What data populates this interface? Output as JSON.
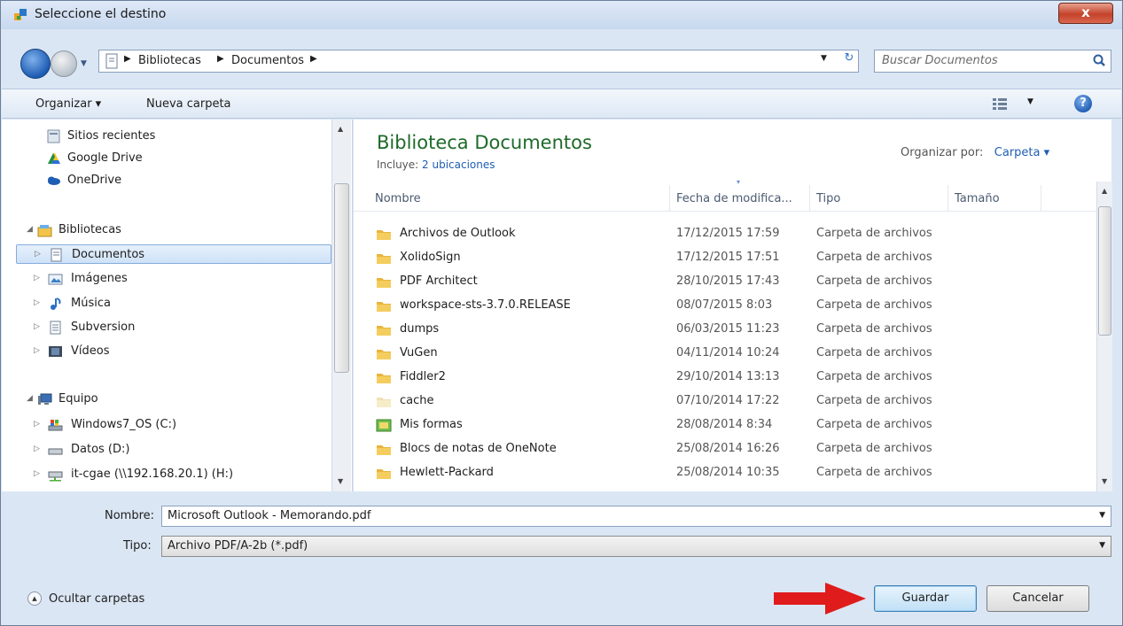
{
  "window": {
    "title": "Seleccione el destino",
    "close_label": "x"
  },
  "address": {
    "crumbs": [
      "Bibliotecas",
      "Documentos"
    ],
    "search_placeholder": "Buscar Documentos"
  },
  "toolbar": {
    "organize": "Organizar ▾",
    "new_folder": "Nueva carpeta"
  },
  "nav": {
    "items": [
      {
        "label": "Sitios recientes",
        "icon": "recent-places-icon"
      },
      {
        "label": "Google Drive",
        "icon": "google-drive-icon"
      },
      {
        "label": "OneDrive",
        "icon": "onedrive-icon"
      },
      {
        "label": "Bibliotecas",
        "icon": "libraries-icon"
      },
      {
        "label": "Documentos",
        "icon": "documents-icon"
      },
      {
        "label": "Imágenes",
        "icon": "pictures-icon"
      },
      {
        "label": "Música",
        "icon": "music-icon"
      },
      {
        "label": "Subversion",
        "icon": "subversion-icon"
      },
      {
        "label": "Vídeos",
        "icon": "videos-icon"
      },
      {
        "label": "Equipo",
        "icon": "computer-icon"
      },
      {
        "label": "Windows7_OS (C:)",
        "icon": "drive-c-icon"
      },
      {
        "label": "Datos (D:)",
        "icon": "drive-d-icon"
      },
      {
        "label": "it-cgae (\\\\192.168.20.1) (H:)",
        "icon": "network-drive-icon"
      }
    ]
  },
  "library": {
    "title": "Biblioteca Documentos",
    "includes_label": "Incluye:",
    "includes_link": "2 ubicaciones",
    "arrange_label": "Organizar por:",
    "arrange_value": "Carpeta ▾"
  },
  "columns": [
    "Nombre",
    "Fecha de modifica...",
    "Tipo",
    "Tamaño"
  ],
  "files": [
    {
      "name": "Archivos de Outlook",
      "date": "17/12/2015 17:59",
      "type": "Carpeta de archivos"
    },
    {
      "name": "XolidoSign",
      "date": "17/12/2015 17:51",
      "type": "Carpeta de archivos"
    },
    {
      "name": "PDF Architect",
      "date": "28/10/2015 17:43",
      "type": "Carpeta de archivos"
    },
    {
      "name": "workspace-sts-3.7.0.RELEASE",
      "date": "08/07/2015 8:03",
      "type": "Carpeta de archivos"
    },
    {
      "name": "dumps",
      "date": "06/03/2015 11:23",
      "type": "Carpeta de archivos"
    },
    {
      "name": "VuGen",
      "date": "04/11/2014 10:24",
      "type": "Carpeta de archivos"
    },
    {
      "name": "Fiddler2",
      "date": "29/10/2014 13:13",
      "type": "Carpeta de archivos"
    },
    {
      "name": "cache",
      "date": "07/10/2014 17:22",
      "type": "Carpeta de archivos"
    },
    {
      "name": "Mis formas",
      "date": "28/08/2014 8:34",
      "type": "Carpeta de archivos"
    },
    {
      "name": "Blocs de notas de OneNote",
      "date": "25/08/2014 16:26",
      "type": "Carpeta de archivos"
    },
    {
      "name": "Hewlett-Packard",
      "date": "25/08/2014 10:35",
      "type": "Carpeta de archivos"
    }
  ],
  "fields": {
    "name_label": "Nombre:",
    "name_value": "Microsoft Outlook - Memorando.pdf",
    "type_label": "Tipo:",
    "type_value": "Archivo PDF/A-2b (*.pdf)"
  },
  "footer": {
    "hide_folders": "Ocultar carpetas",
    "save": "Guardar",
    "cancel": "Cancelar"
  },
  "colors": {
    "library_title": "#1e6a2a",
    "link": "#1f5eb3",
    "arrow": "#e01b1b"
  }
}
